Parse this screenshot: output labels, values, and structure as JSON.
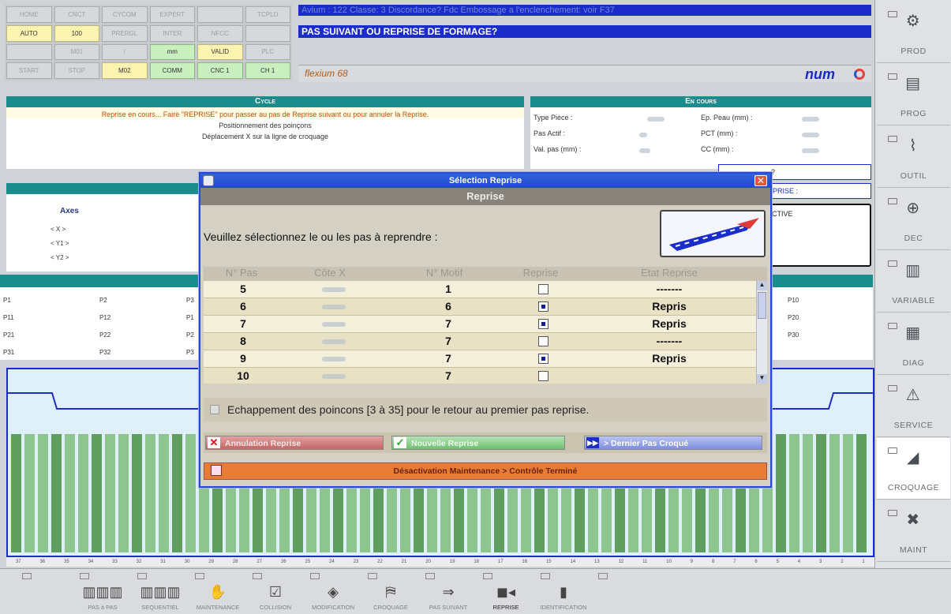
{
  "status_grid": [
    {
      "label": "HOME",
      "state": "off"
    },
    {
      "label": "CNCT",
      "state": "off"
    },
    {
      "label": "CYCOM",
      "state": "off"
    },
    {
      "label": "EXPERT",
      "state": "off"
    },
    {
      "label": "",
      "state": "off"
    },
    {
      "label": "TCPLD",
      "state": "off"
    },
    {
      "label": "AUTO",
      "state": "on-y"
    },
    {
      "label": "100",
      "state": "on-y"
    },
    {
      "label": "PRERGL",
      "state": "off"
    },
    {
      "label": "INTER",
      "state": "off"
    },
    {
      "label": "NFCC",
      "state": "off"
    },
    {
      "label": "",
      "state": "off"
    },
    {
      "label": "",
      "state": "off"
    },
    {
      "label": "M01",
      "state": "off"
    },
    {
      "label": "/",
      "state": "off"
    },
    {
      "label": "mm",
      "state": "on-g"
    },
    {
      "label": "VALID",
      "state": "on-y"
    },
    {
      "label": "PLC",
      "state": "off"
    },
    {
      "label": "START",
      "state": "off"
    },
    {
      "label": "STOP",
      "state": "off"
    },
    {
      "label": "M02",
      "state": "on-y"
    },
    {
      "label": "COMM",
      "state": "on-g"
    },
    {
      "label": "CNC 1",
      "state": "on-g"
    },
    {
      "label": "CH 1",
      "state": "on-g"
    }
  ],
  "messages": {
    "alarm": "Avium : 122 Classe: 3 Discordance? Fdc Embossage a l'enclenchement: voir F37",
    "prompt": "PAS SUIVANT OU REPRISE DE FORMAGE?"
  },
  "brand": {
    "flexium": "flexium 68",
    "num": "num"
  },
  "cycle": {
    "header": "Cycle",
    "warning": "Reprise en cours... Faire \"REPRISE\" pour passer au pas de Reprise suivant ou pour annuler la Reprise.",
    "line1": "Positionnement des poinçons",
    "line2": "Déplacement X sur la ligne de croquage"
  },
  "en_cours": {
    "header": "En cours",
    "type_piece": "Type Pièce :",
    "ep_peau": "Ep. Peau (mm) :",
    "pas_actif": "Pas Actif :",
    "pct": "PCT (mm) :",
    "val_pas": "Val. pas (mm) :",
    "cc": "CC (mm) :"
  },
  "right_info": {
    "line1": "?",
    "line2": "EPRISE :",
    "line3": "ACTIVE"
  },
  "axes": {
    "title": "Axes",
    "items": [
      "< X >",
      "< Y1 >",
      "< Y2 >"
    ]
  },
  "p_labels": {
    "row1": [
      "P1",
      "P2",
      "P3",
      "P10"
    ],
    "row2": [
      "P11",
      "P12",
      "P1",
      "P20"
    ],
    "row3": [
      "P21",
      "P22",
      "P2",
      "P30"
    ],
    "row4": [
      "P31",
      "P32",
      "P3"
    ]
  },
  "scale_ticks": [
    "37",
    "36",
    "35",
    "34",
    "33",
    "32",
    "31",
    "30",
    "29",
    "28",
    "27",
    "26",
    "25",
    "24",
    "23",
    "22",
    "21",
    "20",
    "19",
    "18",
    "17",
    "16",
    "15",
    "14",
    "13",
    "12",
    "11",
    "10",
    "9",
    "8",
    "7",
    "6",
    "5",
    "4",
    "3",
    "2",
    "1"
  ],
  "dialog": {
    "title": "Sélection Reprise",
    "subtitle": "Reprise",
    "prompt": "Veuillez sélectionnez le ou les pas à reprendre :",
    "columns": [
      "N° Pas",
      "Côte X",
      "N° Motif",
      "Reprise",
      "Etat Reprise"
    ],
    "rows": [
      {
        "pas": "5",
        "motif": "1",
        "reprise": false,
        "etat": "-------"
      },
      {
        "pas": "6",
        "motif": "6",
        "reprise": true,
        "etat": "Repris"
      },
      {
        "pas": "7",
        "motif": "7",
        "reprise": true,
        "etat": "Repris"
      },
      {
        "pas": "8",
        "motif": "7",
        "reprise": false,
        "etat": "-------"
      },
      {
        "pas": "9",
        "motif": "7",
        "reprise": true,
        "etat": "Repris"
      },
      {
        "pas": "10",
        "motif": "7",
        "reprise": false,
        "etat": ""
      }
    ],
    "echappement": "Echappement des poincons [3 à 35] pour le retour au premier pas reprise.",
    "btn_annulation": "Annulation Reprise",
    "btn_nouvelle": "Nouvelle Reprise",
    "btn_dernier": "> Dernier Pas Croqué",
    "btn_maintenance": "Désactivation Maintenance > Contrôle Terminé"
  },
  "right_menu": [
    {
      "label": "PROD",
      "icon": "gears-icon"
    },
    {
      "label": "PROG",
      "icon": "program-icon"
    },
    {
      "label": "OUTIL",
      "icon": "tool-icon"
    },
    {
      "label": "DEC",
      "icon": "offset-icon"
    },
    {
      "label": "VARIABLE",
      "icon": "variable-icon"
    },
    {
      "label": "DIAG",
      "icon": "diag-icon"
    },
    {
      "label": "SERVICE",
      "icon": "warning-icon"
    },
    {
      "label": "CROQUAGE",
      "icon": "croquage-icon"
    },
    {
      "label": "MAINT",
      "icon": "maintenance-icon"
    }
  ],
  "bottom_menu": [
    {
      "label": "",
      "icon": ""
    },
    {
      "label": "PAS à PAS",
      "icon": "step-icon"
    },
    {
      "label": "SEQUENTIEL",
      "icon": "sequence-icon"
    },
    {
      "label": "MAINTENANCE",
      "icon": "hand-icon"
    },
    {
      "label": "COLLISION",
      "icon": "collision-icon"
    },
    {
      "label": "MODIFICATION",
      "icon": "modify-icon"
    },
    {
      "label": "CROQUAGE",
      "icon": "croquage-icon"
    },
    {
      "label": "PAS SUIVANT",
      "icon": "next-step-icon"
    },
    {
      "label": "REPRISE",
      "icon": "reprise-icon"
    },
    {
      "label": "IDENTIFICATION",
      "icon": "id-icon"
    },
    {
      "label": "",
      "icon": ""
    }
  ]
}
